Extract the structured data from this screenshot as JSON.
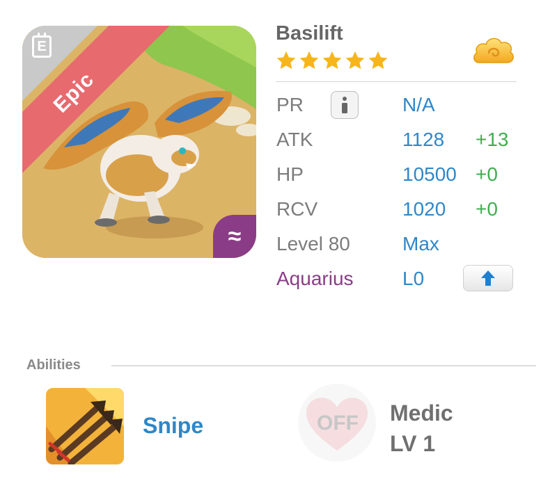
{
  "monster": {
    "name": "Basilift",
    "stars": 5,
    "rarity": "Epic",
    "element_symbol": "≈",
    "rarity_icon_letter": "E"
  },
  "stats": {
    "pr": {
      "label": "PR",
      "value": "N/A"
    },
    "atk": {
      "label": "ATK",
      "value": "1128",
      "bonus": "+13"
    },
    "hp": {
      "label": "HP",
      "value": "10500",
      "bonus": "+0"
    },
    "rcv": {
      "label": "RCV",
      "value": "1020",
      "bonus": "+0"
    },
    "level": {
      "label": "Level 80",
      "value": "Max"
    },
    "constellation": {
      "label": "Aquarius",
      "value": "L0"
    }
  },
  "abilities": {
    "title": "Abilities",
    "skill": {
      "name": "Snipe"
    },
    "passive": {
      "status": "OFF",
      "name": "Medic",
      "level": "LV 1"
    }
  },
  "colors": {
    "value_blue": "#2f87c8",
    "bonus_green": "#3fae4f",
    "constellation_purple": "#8a3d86",
    "epic_red": "#e76a6f",
    "star_gold": "#f7b51c"
  }
}
